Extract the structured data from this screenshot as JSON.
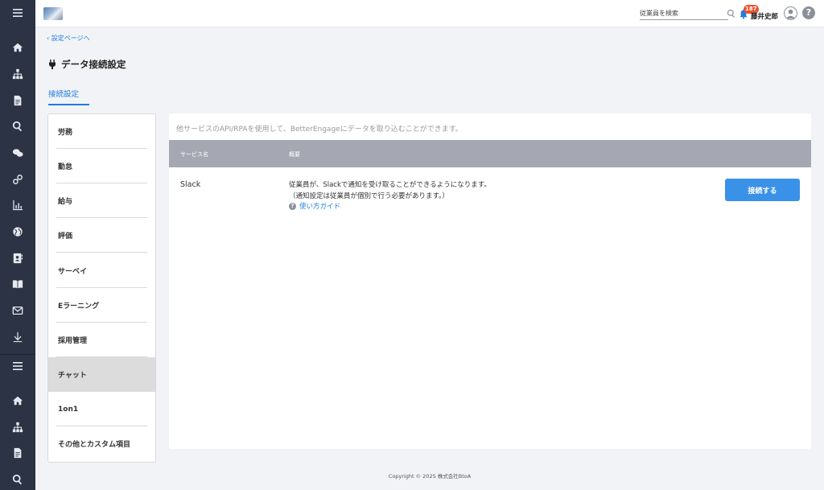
{
  "rail": {
    "icons": [
      "menu-icon",
      "home-icon",
      "org-chart-icon",
      "document-icon",
      "search-icon",
      "chat-icon",
      "link-icon",
      "chart-icon",
      "globe-icon",
      "contact-icon",
      "book-icon",
      "mail-icon",
      "download-icon",
      "menu-icon",
      "home-icon",
      "org-chart-icon",
      "document-icon",
      "search-icon"
    ]
  },
  "header": {
    "search_placeholder": "従業員を検索",
    "notification_count": "187",
    "user_name": "藤井史郎",
    "help_label": "?"
  },
  "breadcrumb": {
    "back_label": "設定ページへ"
  },
  "page": {
    "title": "データ接続設定"
  },
  "tabs": [
    {
      "label": "接続設定",
      "active": true
    }
  ],
  "categories": [
    {
      "label": "労務"
    },
    {
      "label": "勤怠"
    },
    {
      "label": "給与"
    },
    {
      "label": "評価"
    },
    {
      "label": "サーベイ"
    },
    {
      "label": "Eラーニング"
    },
    {
      "label": "採用管理"
    },
    {
      "label": "チャット",
      "active": true
    },
    {
      "label": "1on1"
    },
    {
      "label": "その他とカスタム項目"
    }
  ],
  "main": {
    "description": "他サービスのAPI/RPAを使用して、BetterEngageにデータを取り込むことができます。",
    "columns": [
      "サービス名",
      "概要"
    ],
    "rows": [
      {
        "service": "Slack",
        "summary_line1": "従業員が、Slackで通知を受け取ることができるようになります。",
        "summary_line2": "（通知設定は従業員が個別で行う必要があります。）",
        "guide_label": "使い方ガイド",
        "action_label": "接続する"
      }
    ]
  },
  "footer": {
    "copyright": "Copyright © 2025 株式会社BtoA"
  },
  "colors": {
    "accent": "#1e7de0",
    "button": "#3a91e8",
    "rail": "#2b3344",
    "table_header": "#a5a8b2",
    "badge": "#e8542f"
  }
}
